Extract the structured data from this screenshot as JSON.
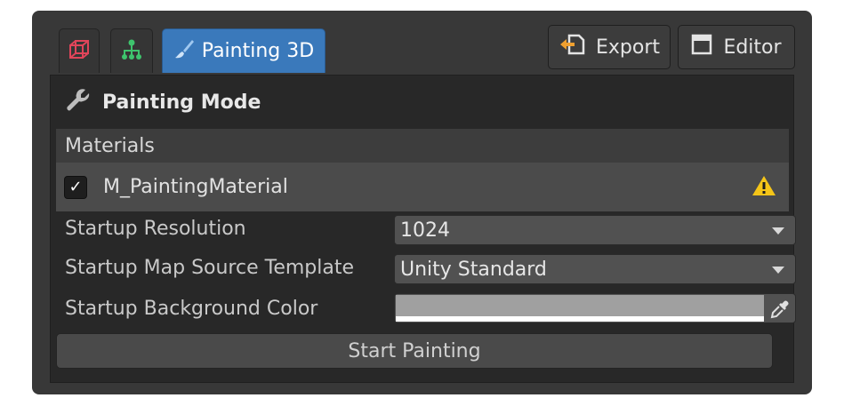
{
  "tabs": [
    {
      "icon": "cube-outline-icon",
      "label": ""
    },
    {
      "icon": "hierarchy-icon",
      "label": ""
    },
    {
      "icon": "paintbrush-icon",
      "label": "Painting 3D"
    }
  ],
  "toolbar": {
    "export_label": "Export",
    "editor_label": "Editor"
  },
  "panel": {
    "title": "Painting Mode",
    "materials_section": "Materials",
    "material": {
      "name": "M_PaintingMaterial",
      "checked": true,
      "warning": true
    },
    "properties": {
      "resolution_label": "Startup Resolution",
      "resolution_value": "1024",
      "template_label": "Startup Map Source Template",
      "template_value": "Unity Standard",
      "background_label": "Startup Background Color",
      "background_color": "#a0a0a0"
    },
    "start_button": "Start Painting"
  },
  "colors": {
    "window_bg": "#383838",
    "panel_bg": "#282828",
    "active_tab": "#3a79bb",
    "warning": "#f5c518",
    "cube_icon": "#e0455a",
    "hierarchy_icon": "#3ec46d"
  }
}
